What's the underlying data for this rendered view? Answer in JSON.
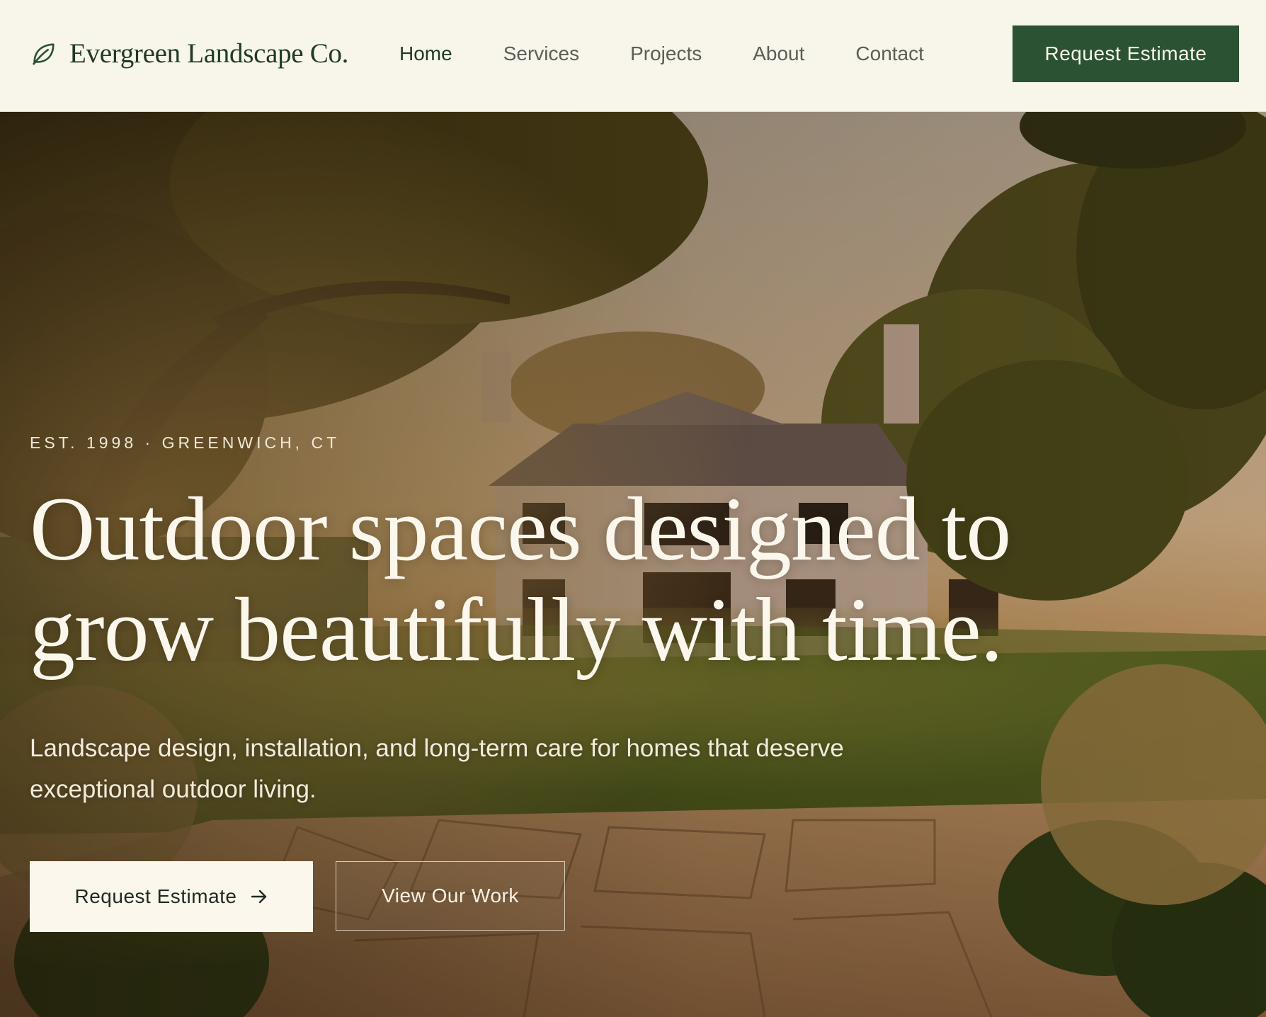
{
  "brand": {
    "name": "Evergreen Landscape Co.",
    "logo_icon": "leaf-icon",
    "primary_color": "#2a5233",
    "cream_color": "#f8f5ea"
  },
  "nav": {
    "items": [
      {
        "label": "Home",
        "active": true
      },
      {
        "label": "Services",
        "active": false
      },
      {
        "label": "Projects",
        "active": false
      },
      {
        "label": "About",
        "active": false
      },
      {
        "label": "Contact",
        "active": false
      }
    ],
    "cta_label": "Request Estimate"
  },
  "hero": {
    "eyebrow": "EST. 1998 · GREENWICH, CT",
    "headline": "Outdoor spaces designed to grow beautifully with time.",
    "subhead": "Landscape design, installation, and long-term care for homes that deserve exceptional outdoor living.",
    "primary_button": "Request Estimate",
    "primary_button_icon": "arrow-right-icon",
    "secondary_button": "View Our Work"
  }
}
